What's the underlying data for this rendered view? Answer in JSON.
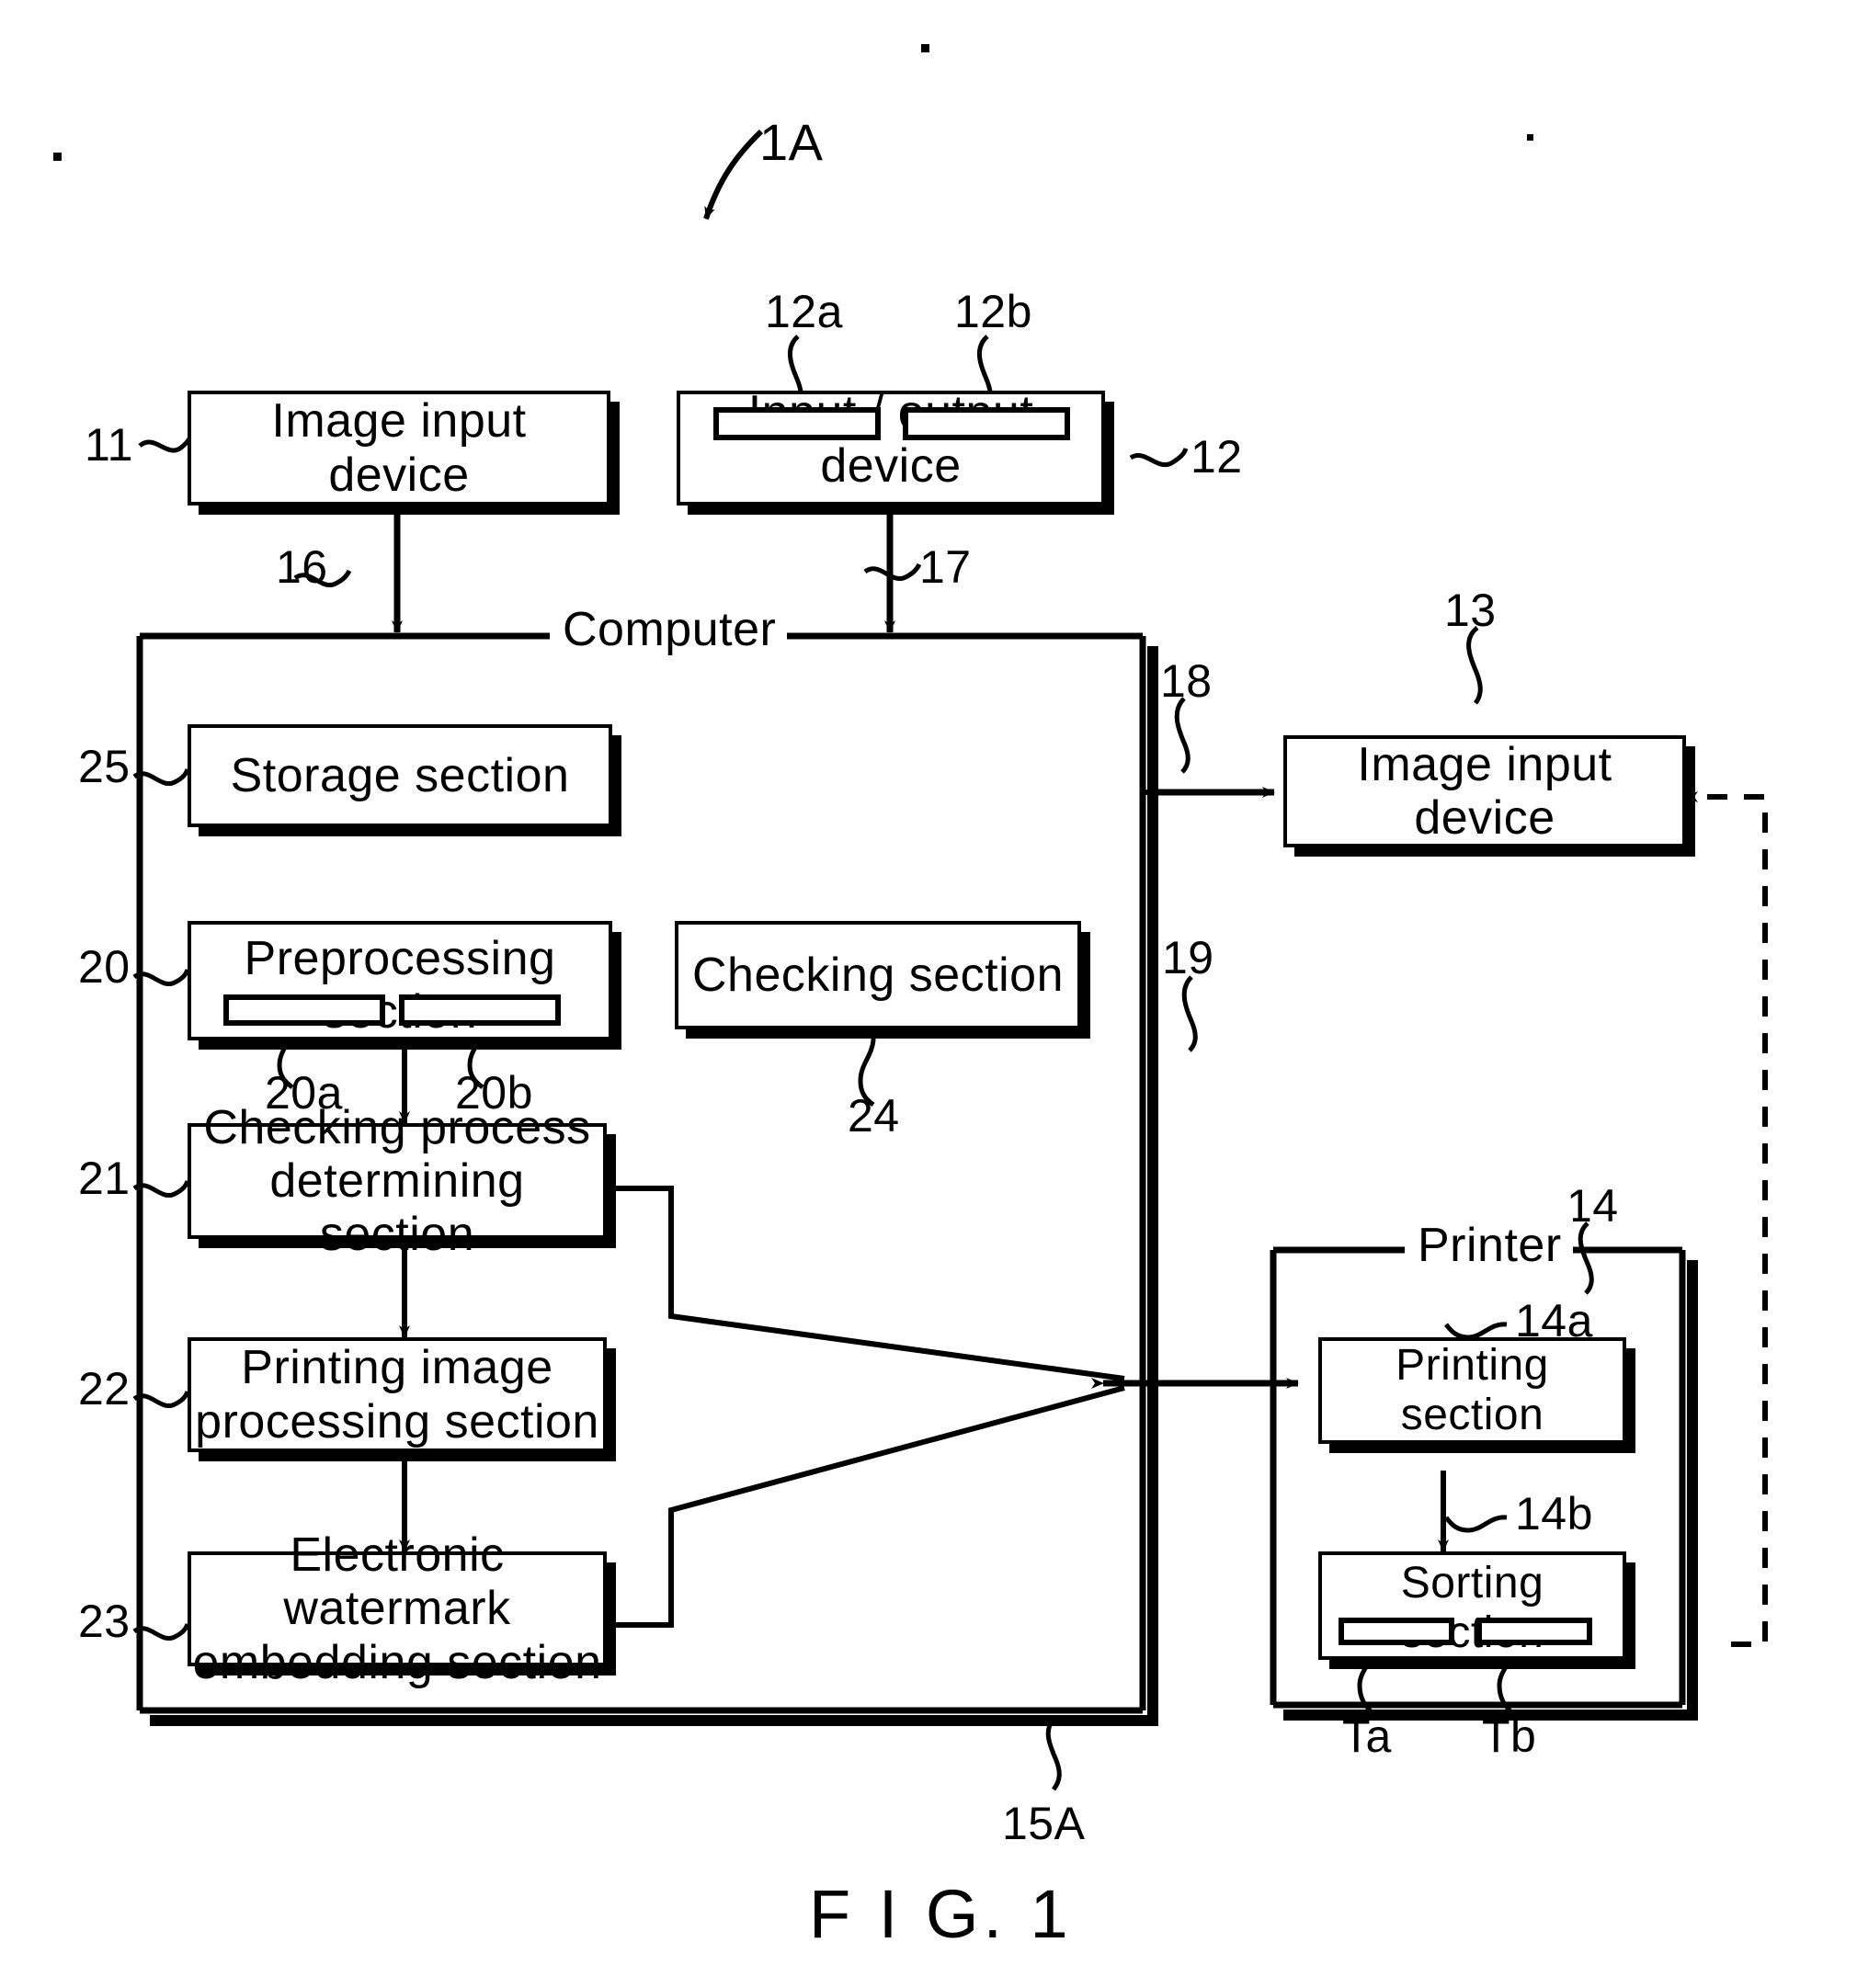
{
  "figure": {
    "caption": "F I G. 1",
    "system_ref": "1A"
  },
  "nodes": {
    "image_input_device_left": {
      "label": "Image input device",
      "ref": "11"
    },
    "input_output_device": {
      "label": "Input / output device",
      "ref": "12",
      "port_a_ref": "12a",
      "port_b_ref": "12b"
    },
    "image_input_device_right": {
      "label": "Image input device",
      "ref": "13"
    },
    "computer": {
      "label": "Computer",
      "ref": "15A"
    },
    "printer": {
      "label": "Printer",
      "ref": "14"
    },
    "storage_section": {
      "label": "Storage  section",
      "ref": "25"
    },
    "preprocessing_section": {
      "label": "Preprocessing  section",
      "ref": "20",
      "port_a_ref": "20a",
      "port_b_ref": "20b"
    },
    "checking_section": {
      "label": "Checking section",
      "ref": "24"
    },
    "checking_process_determining_section": {
      "line1": "Checking  process",
      "line2": "determining  section",
      "ref": "21"
    },
    "printing_image_processing_section": {
      "line1": "Printing  image",
      "line2": "processing  section",
      "ref": "22"
    },
    "electronic_watermark_embedding_section": {
      "line1": "Electronic  watermark",
      "line2": "embedding  section",
      "ref": "23"
    },
    "printing_section": {
      "label": "Printing  section",
      "ref": "14a"
    },
    "sorting_section": {
      "label": "Sorting  section",
      "ref": "14b",
      "tray_a_ref": "Ta",
      "tray_b_ref": "Tb"
    }
  },
  "connections": {
    "image_input_to_computer": {
      "ref": "16"
    },
    "io_device_to_computer": {
      "ref": "17"
    },
    "computer_to_image_input_right": {
      "ref": "18"
    },
    "computer_to_printer": {
      "ref": "19"
    }
  },
  "colors": {
    "ink": "#000000",
    "paper": "#ffffff"
  }
}
